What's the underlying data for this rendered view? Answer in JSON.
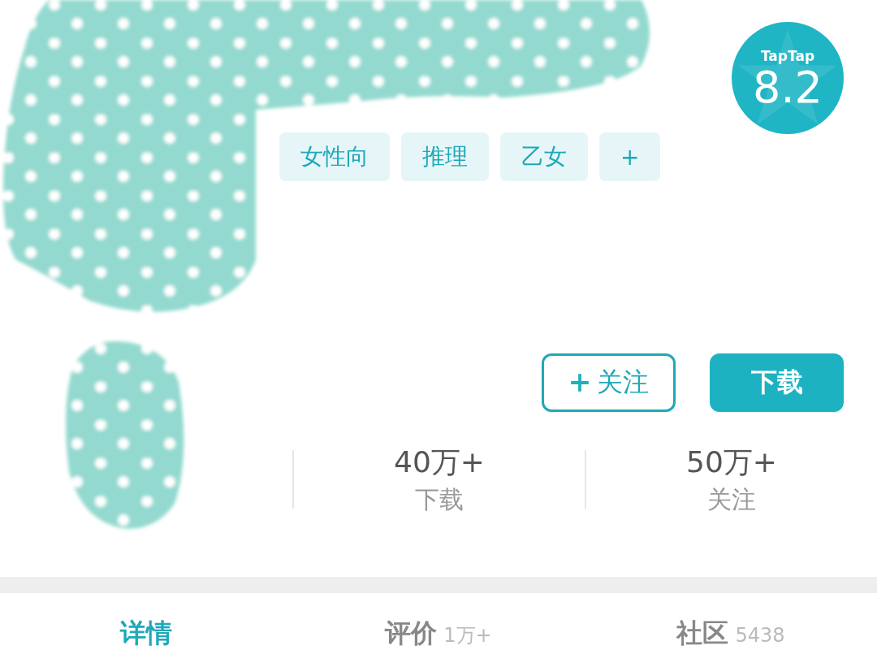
{
  "rating": {
    "brand": "TapTap",
    "score": "8.2"
  },
  "tags": [
    {
      "label": "女性向"
    },
    {
      "label": "推理"
    },
    {
      "label": "乙女"
    },
    {
      "label": "+"
    }
  ],
  "actions": [
    {
      "kind": "follow",
      "label": "关注"
    },
    {
      "kind": "download",
      "label": "下载"
    }
  ],
  "stats": [
    {
      "value": "40万+",
      "label": "下载"
    },
    {
      "value": "50万+",
      "label": "关注"
    }
  ],
  "tabs": [
    {
      "label": "详情",
      "selected": true
    },
    {
      "label": "评价",
      "count": "1万+",
      "selected": false
    },
    {
      "label": "社区",
      "count": "5438",
      "selected": false
    }
  ]
}
